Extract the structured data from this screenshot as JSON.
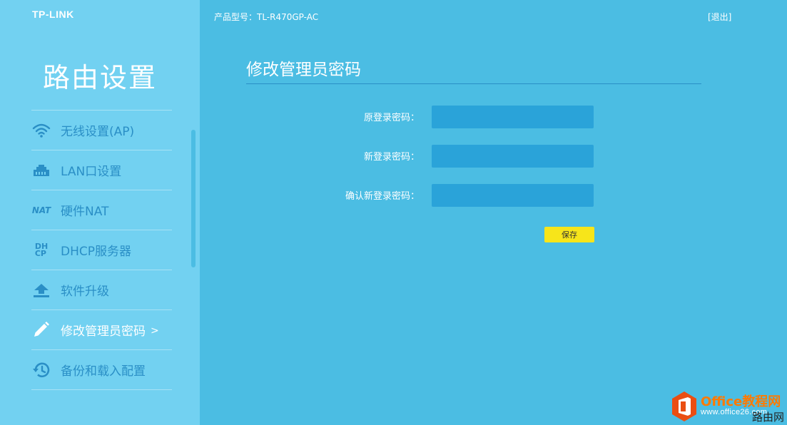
{
  "brand": {
    "logo_text": "TP-LINK"
  },
  "sidebar": {
    "title": "路由设置",
    "items": [
      {
        "label": "无线设置(AP)",
        "icon": "wifi-icon"
      },
      {
        "label": "LAN口设置",
        "icon": "lan-port-icon"
      },
      {
        "label": "硬件NAT",
        "icon": "nat-icon",
        "icon_text": "NAT"
      },
      {
        "label": "DHCP服务器",
        "icon": "dhcp-icon",
        "icon_text_top": "DH",
        "icon_text_bottom": "CP"
      },
      {
        "label": "软件升级",
        "icon": "upload-icon"
      },
      {
        "label": "修改管理员密码",
        "icon": "pencil-icon",
        "active": true,
        "chevron": ">"
      },
      {
        "label": "备份和载入配置",
        "icon": "history-icon"
      }
    ]
  },
  "header": {
    "model": "产品型号：TL-R470GP-AC",
    "logout": "[退出]"
  },
  "main": {
    "title": "修改管理员密码",
    "fields": [
      {
        "label": "原登录密码：",
        "value": ""
      },
      {
        "label": "新登录密码：",
        "value": ""
      },
      {
        "label": "确认新登录密码：",
        "value": ""
      }
    ],
    "save_label": "保存"
  },
  "watermark": {
    "line1": "Office教程网",
    "line2": "www.office26.com",
    "line3": "路由网"
  },
  "colors": {
    "sidebar_bg": "#72d1f1",
    "main_bg": "#4bbde3",
    "accent_dark": "#2a8fc6",
    "input_bg": "#2aa3d9",
    "save_button": "#f7e51a",
    "watermark_orange": "#ff7a00"
  }
}
